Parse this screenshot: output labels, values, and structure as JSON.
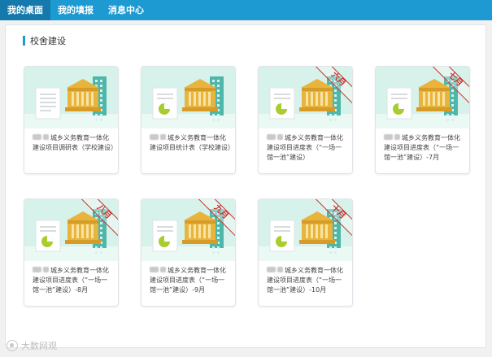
{
  "nav": {
    "tabs": [
      {
        "label": "我的桌面",
        "active": true
      },
      {
        "label": "我的填报",
        "active": false
      },
      {
        "label": "消息中心",
        "active": false
      }
    ]
  },
  "section": {
    "title": "校舍建设"
  },
  "colors": {
    "accent": "#1e9ad3",
    "nav_active": "#1579ab",
    "ribbon": "#c9302c",
    "card_bg": "#d7f2ea",
    "chart": "#a9cc2e",
    "building": "#e9b43b"
  },
  "cards": [
    {
      "caption": "城乡义务教育一体化建设项目调研表（学校建设）",
      "ribbon": "",
      "doc_icon": "document-lines-icon"
    },
    {
      "caption": "城乡义务教育一体化建设项目统计表（学校建设）",
      "ribbon": "",
      "doc_icon": "pie-chart-document-icon"
    },
    {
      "caption": "城乡义务教育一体化建设项目进度表（“一场一馆一池”建设）",
      "ribbon": "六月",
      "doc_icon": "pie-chart-document-icon"
    },
    {
      "caption": "城乡义务教育一体化建设项目进度表（“一场一馆一池”建设）-7月",
      "ribbon": "七月",
      "doc_icon": "pie-chart-document-icon"
    },
    {
      "caption": "城乡义务教育一体化建设项目进度表（“一场一馆一池”建设）-8月",
      "ribbon": "八月",
      "doc_icon": "pie-chart-document-icon"
    },
    {
      "caption": "城乡义务教育一体化建设项目进度表（“一场一馆一池”建设）-9月",
      "ribbon": "九月",
      "doc_icon": "pie-chart-document-icon"
    },
    {
      "caption": "城乡义务教育一体化建设项目进度表（“一场一馆一池”建设）-10月",
      "ribbon": "十月",
      "doc_icon": "pie-chart-document-icon"
    }
  ],
  "watermark": {
    "text": "大数网观",
    "icon": "watermark-logo-icon"
  }
}
